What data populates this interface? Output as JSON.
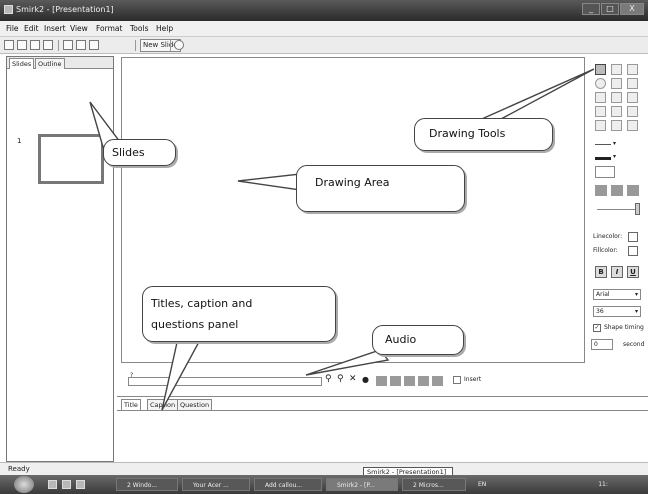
{
  "window": {
    "title": "Smirk2 - [Presentation1]",
    "buttons": [
      "_",
      "□",
      "X"
    ]
  },
  "menu": [
    "File",
    "Edit",
    "Insert",
    "View",
    "Format",
    "Tools",
    "Help"
  ],
  "toolbar": {
    "new_slide_label": "New Slide",
    "icons": [
      "new-doc-icon",
      "open-folder-icon",
      "save-icon",
      "print-icon",
      "cut-icon",
      "copy-icon",
      "paste-icon",
      "help-icon"
    ]
  },
  "slides_panel": {
    "tabs": [
      "Slides",
      "Outline"
    ],
    "active_tab": "Slides",
    "slides": [
      {
        "number": "1"
      }
    ]
  },
  "bottom_panel": {
    "tabs": [
      "Title",
      "Caption",
      "Question"
    ],
    "active_tab": "Title"
  },
  "audio": {
    "marker": "?",
    "insert_label": "Insert"
  },
  "tools_panel": {
    "line_color_label": "Linecolor:",
    "fill_color_label": "Fillcolor:",
    "bold_label": "B",
    "italic_label": "I",
    "underline_label": "U",
    "font_value": "Arial",
    "size_value": "36",
    "shape_timing_label": "Shape timing",
    "shape_timing_checked": true,
    "seconds_value": "0",
    "seconds_label": "second"
  },
  "status": {
    "text": "Ready",
    "tooltip": "Smirk2 - [Presentation1]"
  },
  "taskbar": {
    "items": [
      "2 Windo...",
      "Your Acer ...",
      "Add callou...",
      "Smirk2 - [P...",
      "2 Micros..."
    ],
    "tray_text": "EN",
    "clock": "11:"
  },
  "callouts": {
    "slides": "Slides",
    "drawing_tools": "Drawing Tools",
    "drawing_area": "Drawing Area",
    "titles_panel_line1": "Titles, caption and",
    "titles_panel_line2": "questions panel",
    "audio": "Audio"
  }
}
